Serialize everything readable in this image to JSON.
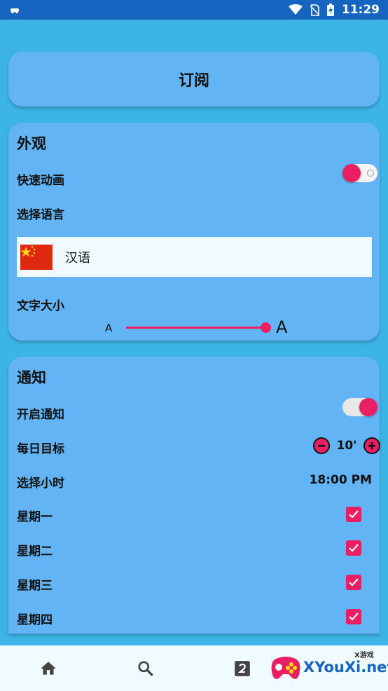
{
  "status_bar": {
    "time": "11:29",
    "icons": [
      "notification-icon",
      "wifi-icon",
      "no-sim-icon",
      "battery-charging-icon"
    ]
  },
  "subscribe": {
    "label": "订阅"
  },
  "appearance": {
    "title": "外观",
    "fast_animation": {
      "label": "快速动画",
      "enabled": false
    },
    "language": {
      "label": "选择语言",
      "selected": "汉语",
      "flag_icon": "china-flag-icon"
    },
    "text_size": {
      "label": "文字大小",
      "small_marker": "A",
      "large_marker": "A",
      "value": 1.0
    }
  },
  "notifications": {
    "title": "通知",
    "enable": {
      "label": "开启通知",
      "enabled": true
    },
    "daily_goal": {
      "label": "每日目标",
      "value": "10'"
    },
    "hour": {
      "label": "选择小时",
      "value": "18:00 PM"
    },
    "days": [
      {
        "label": "星期一",
        "checked": true
      },
      {
        "label": "星期二",
        "checked": true
      },
      {
        "label": "星期三",
        "checked": true
      },
      {
        "label": "星期四",
        "checked": true
      }
    ]
  },
  "bottom_nav": {
    "items": [
      "home-icon",
      "search-icon",
      "number-2-icon"
    ]
  },
  "watermark": {
    "small_text": "X游戏",
    "text": "XYouXi.net"
  },
  "colors": {
    "background": "#3cb4e6",
    "card": "#62b4f4",
    "accent": "#e91e63",
    "status_bar": "#1565c0",
    "panel": "#effbff"
  }
}
